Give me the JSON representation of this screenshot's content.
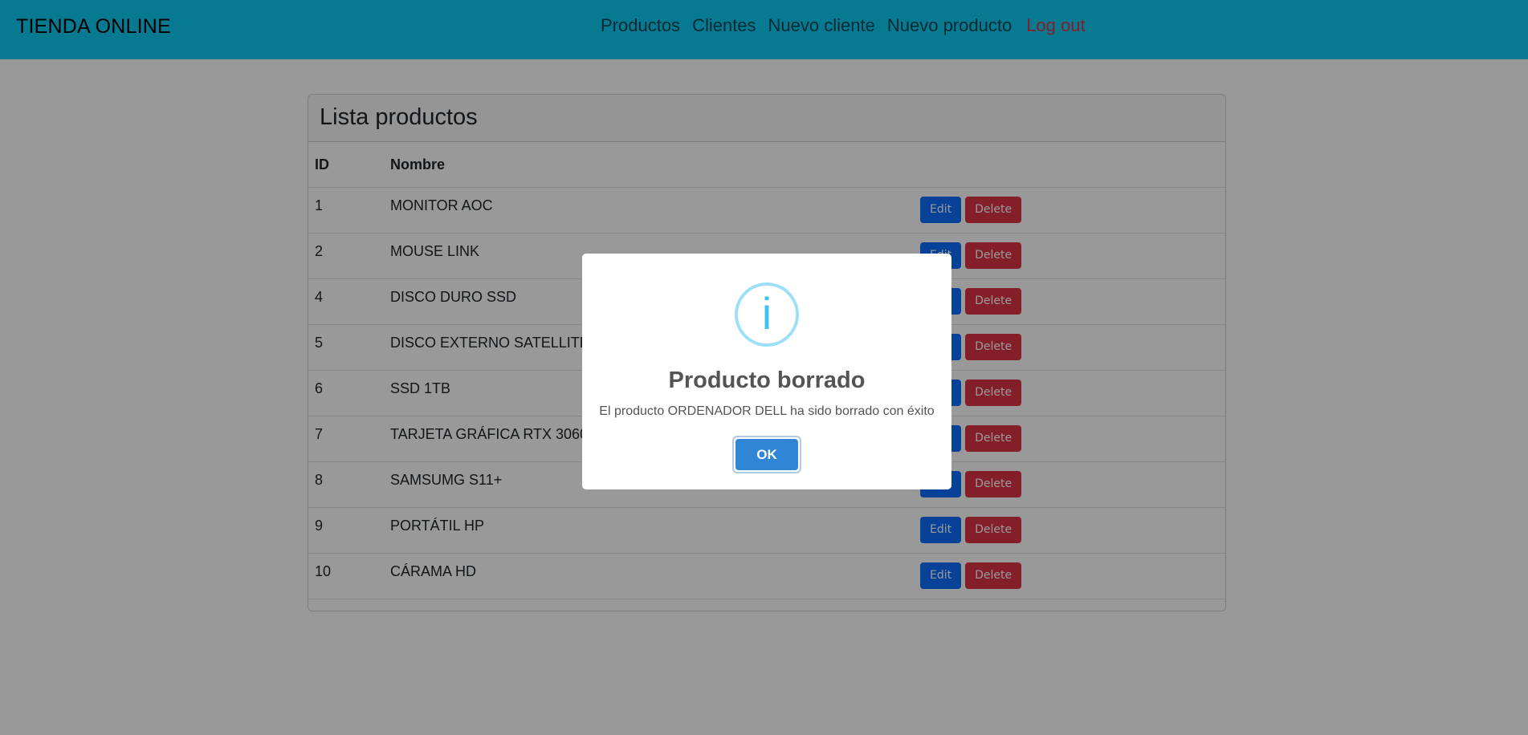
{
  "navbar": {
    "brand": "TIENDA ONLINE",
    "links": [
      "Productos",
      "Clientes",
      "Nuevo cliente",
      "Nuevo producto"
    ],
    "logout": "Log out"
  },
  "card": {
    "title": "Lista productos",
    "columns": {
      "id": "ID",
      "name": "Nombre"
    },
    "rows": [
      {
        "id": "1",
        "name": "MONITOR AOC"
      },
      {
        "id": "2",
        "name": "MOUSE LINK"
      },
      {
        "id": "4",
        "name": "DISCO DURO SSD"
      },
      {
        "id": "5",
        "name": "DISCO EXTERNO SATELLITE"
      },
      {
        "id": "6",
        "name": "SSD 1TB"
      },
      {
        "id": "7",
        "name": "TARJETA GRÁFICA RTX 3060"
      },
      {
        "id": "8",
        "name": "SAMSUMG S11+"
      },
      {
        "id": "9",
        "name": "PORTÁTIL HP"
      },
      {
        "id": "10",
        "name": "CÁRAMA HD"
      }
    ],
    "edit_label": "Edit",
    "delete_label": "Delete"
  },
  "modal": {
    "icon": "info-icon",
    "icon_glyph": "i",
    "title": "Producto borrado",
    "text": "El producto ORDENADOR DELL ha sido borrado con éxito",
    "ok_label": "OK"
  },
  "colors": {
    "navbar": "#0dcaf0",
    "edit": "#0d6efd",
    "delete": "#dc3545",
    "logout": "#dc3545",
    "ok": "#3085d6"
  }
}
